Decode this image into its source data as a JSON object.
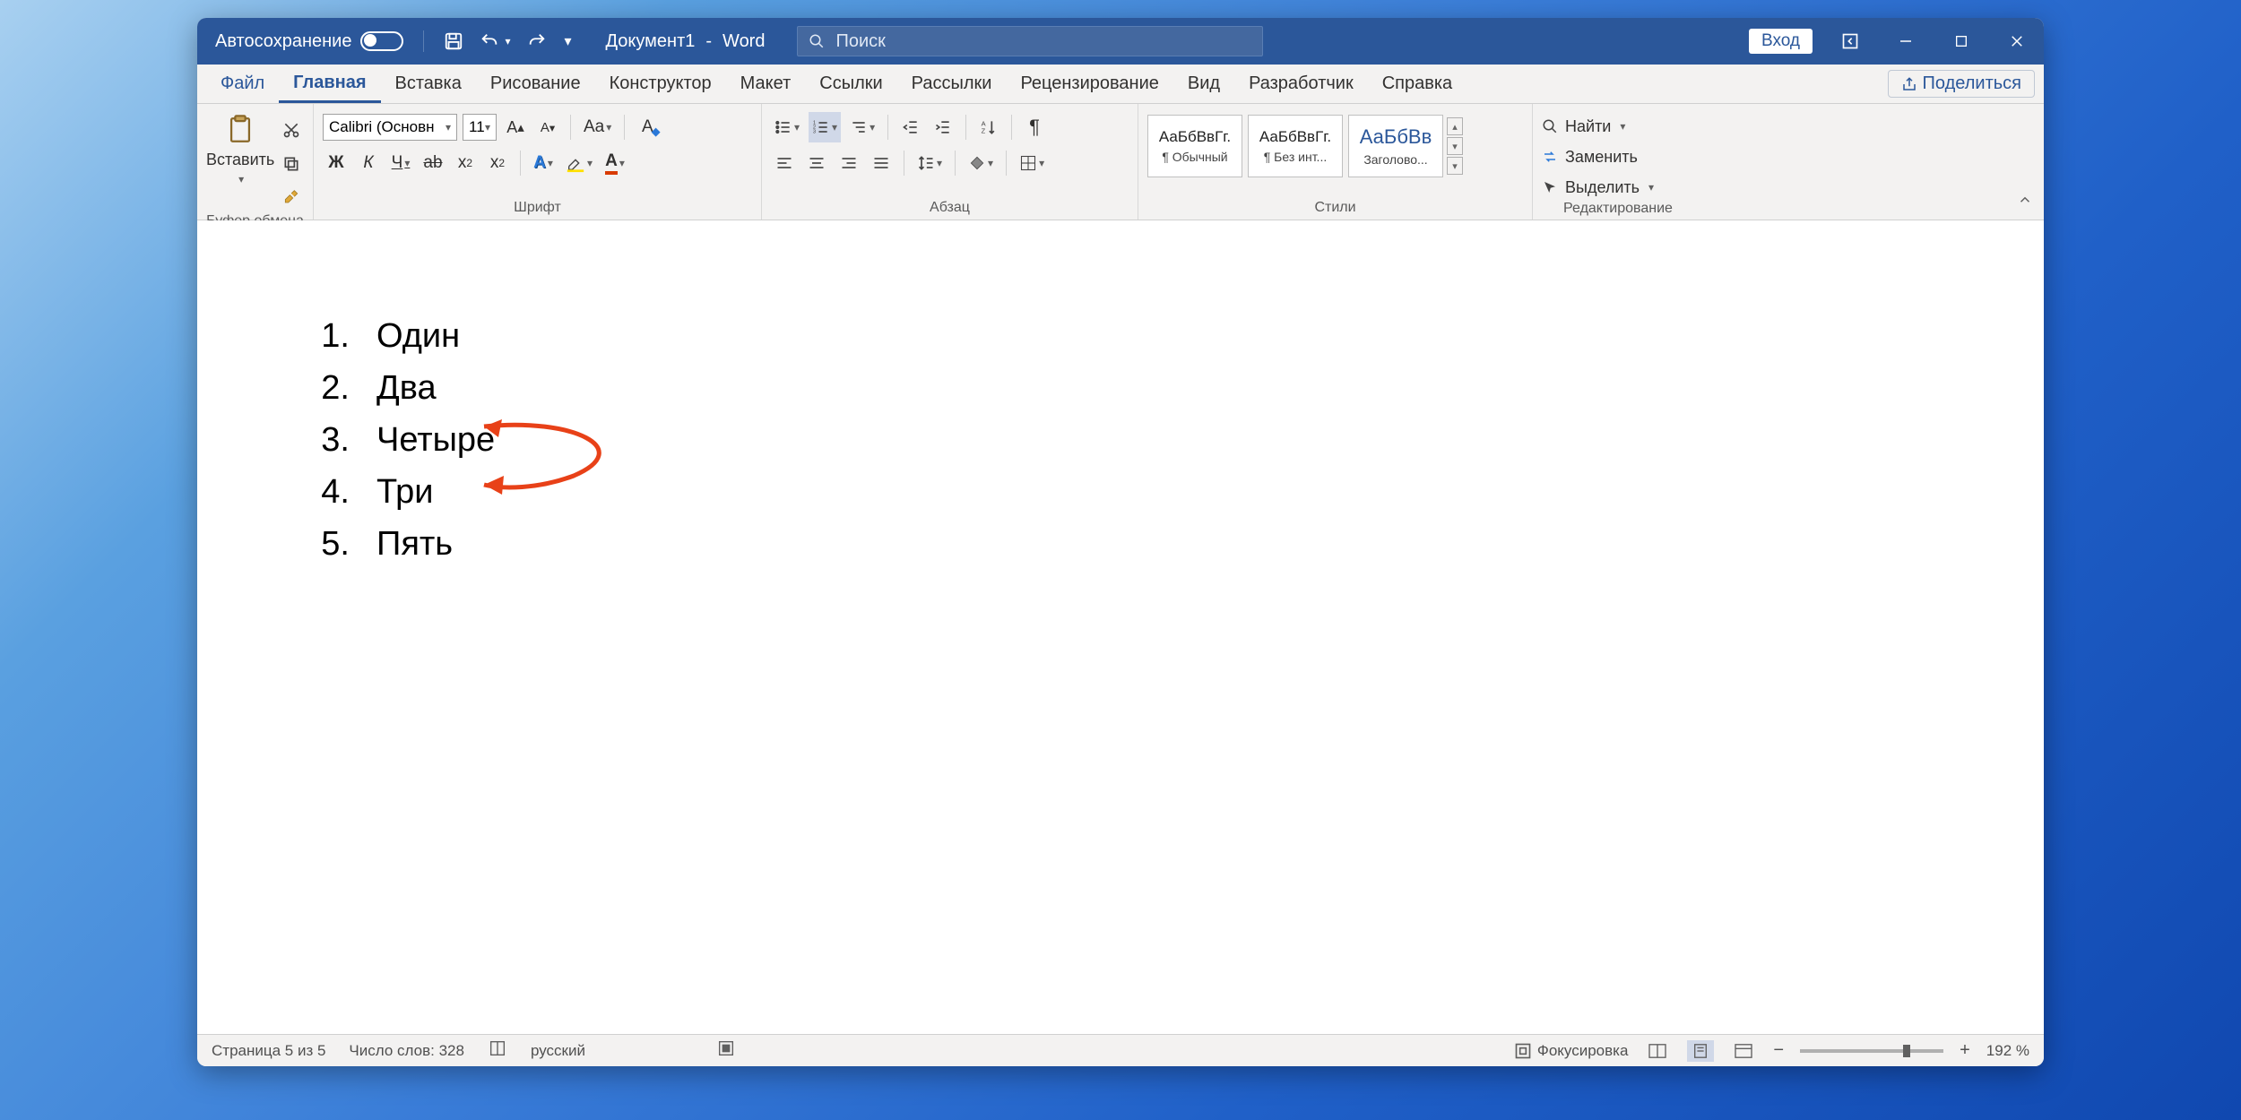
{
  "title": {
    "autosave": "Автосохранение",
    "doc": "Документ1",
    "sep": "-",
    "app": "Word"
  },
  "search": {
    "placeholder": "Поиск"
  },
  "wincontrols": {
    "login": "Вход"
  },
  "tabs": [
    "Файл",
    "Главная",
    "Вставка",
    "Рисование",
    "Конструктор",
    "Макет",
    "Ссылки",
    "Рассылки",
    "Рецензирование",
    "Вид",
    "Разработчик",
    "Справка"
  ],
  "share": "Поделиться",
  "groups": {
    "clipboard": {
      "label": "Буфер обмена",
      "paste": "Вставить"
    },
    "font": {
      "label": "Шрифт",
      "name": "Calibri (Основн",
      "size": "11",
      "bold": "Ж",
      "italic": "К",
      "underline": "Ч"
    },
    "paragraph": {
      "label": "Абзац"
    },
    "styles": {
      "label": "Стили",
      "cards": [
        {
          "sample": "АаБбВвГг.",
          "name": "¶ Обычный"
        },
        {
          "sample": "АаБбВвГг.",
          "name": "¶ Без инт..."
        },
        {
          "sample": "АаБбВв",
          "name": "Заголово...",
          "blue": true
        }
      ]
    },
    "editing": {
      "label": "Редактирование",
      "find": "Найти",
      "replace": "Заменить",
      "select": "Выделить"
    }
  },
  "doc_list": [
    {
      "n": "1.",
      "text": "Один"
    },
    {
      "n": "2.",
      "text": "Два"
    },
    {
      "n": "3.",
      "text": "Четыре"
    },
    {
      "n": "4.",
      "text": "Три"
    },
    {
      "n": "5.",
      "text": "Пять"
    }
  ],
  "status": {
    "page": "Страница 5 из 5",
    "words": "Число слов: 328",
    "lang": "русский",
    "focus": "Фокусировка",
    "zoom": "192 %"
  }
}
